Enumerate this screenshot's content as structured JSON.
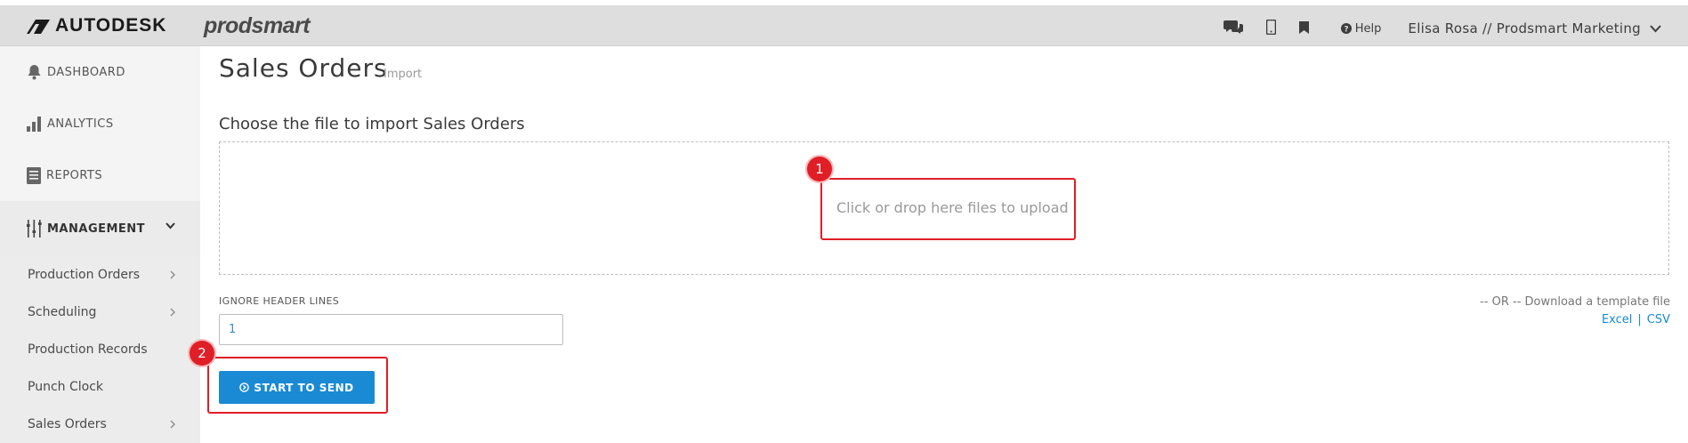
{
  "topbar": {
    "brand": "AUTODESK",
    "product": "prodsmart",
    "help_label": "Help",
    "user_label": "Elisa Rosa // Prodsmart Marketing",
    "icons": [
      "chat-icon",
      "mobile-icon",
      "bookmark-icon",
      "question-circle-icon",
      "chevron-down-icon"
    ]
  },
  "sidebar": {
    "main_items": [
      {
        "label": "DASHBOARD",
        "icon": "bell-icon"
      },
      {
        "label": "ANALYTICS",
        "icon": "bar-chart-icon"
      },
      {
        "label": "REPORTS",
        "icon": "document-icon"
      },
      {
        "label": "MANAGEMENT",
        "icon": "sliders-icon"
      }
    ],
    "sub_items": [
      {
        "label": "Production Orders",
        "has_chevron": true
      },
      {
        "label": "Scheduling",
        "has_chevron": true
      },
      {
        "label": "Production Records",
        "has_chevron": false
      },
      {
        "label": "Punch Clock",
        "has_chevron": false
      },
      {
        "label": "Sales Orders",
        "has_chevron": true
      }
    ]
  },
  "page": {
    "title": "Sales Orders",
    "subtitle": "Import",
    "section_title": "Choose the file to import Sales Orders",
    "dropzone_text": "Click or drop here files to upload",
    "ignore_label": "IGNORE HEADER LINES",
    "ignore_value": "1",
    "or_text": "-- OR -- Download a template file",
    "link_excel": "Excel",
    "link_sep": "|",
    "link_csv": "CSV",
    "send_label": "START TO SEND"
  },
  "annotations": {
    "badge_1": "1",
    "badge_2": "2",
    "highlight_color": "#e01e26"
  },
  "colors": {
    "accent": "#1a8ad4",
    "topbar_bg": "#dedede",
    "sidebar_bg": "#f4f4f4"
  }
}
